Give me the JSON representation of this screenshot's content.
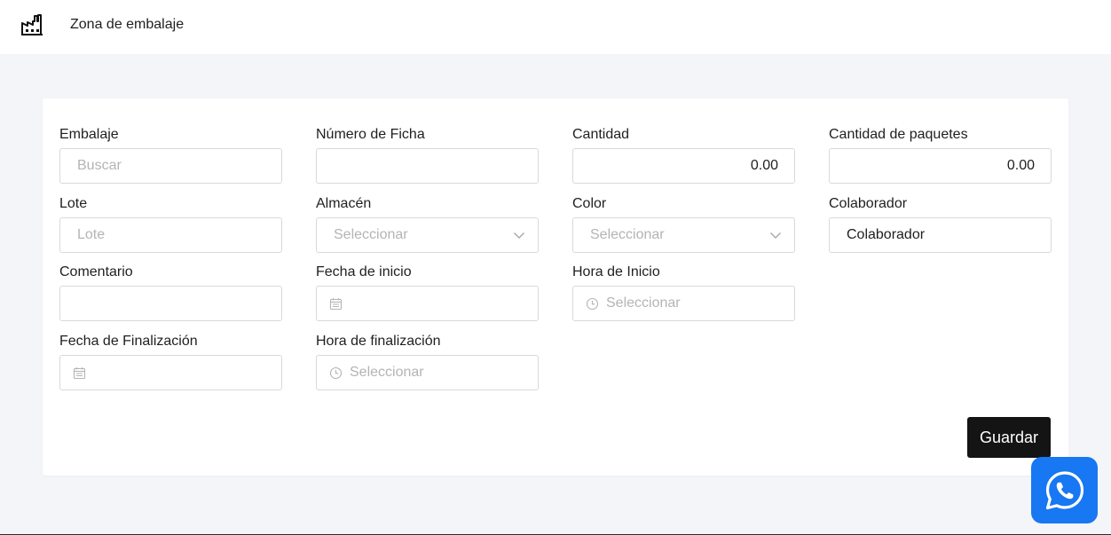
{
  "header": {
    "title": "Zona de embalaje",
    "logo_icon": "factory-icon"
  },
  "form": {
    "embalaje": {
      "label": "Embalaje",
      "placeholder": "Buscar",
      "value": ""
    },
    "numero_ficha": {
      "label": "Número de Ficha",
      "value": ""
    },
    "cantidad": {
      "label": "Cantidad",
      "value": "0.00"
    },
    "cantidad_paquetes": {
      "label": "Cantidad de paquetes",
      "value": "0.00"
    },
    "lote": {
      "label": "Lote",
      "placeholder": "Lote",
      "value": ""
    },
    "almacen": {
      "label": "Almacén",
      "placeholder": "Seleccionar",
      "value": ""
    },
    "color": {
      "label": "Color",
      "placeholder": "Seleccionar",
      "value": ""
    },
    "colaborador": {
      "label": "Colaborador",
      "value": "Colaborador"
    },
    "comentario": {
      "label": "Comentario",
      "value": ""
    },
    "fecha_inicio": {
      "label": "Fecha de inicio",
      "value": ""
    },
    "hora_inicio": {
      "label": "Hora de Inicio",
      "placeholder": "Seleccionar",
      "value": ""
    },
    "fecha_fin": {
      "label": "Fecha de Finalización",
      "value": ""
    },
    "hora_fin": {
      "label": "Hora de finalización",
      "placeholder": "Seleccionar",
      "value": ""
    }
  },
  "actions": {
    "save_label": "Guardar"
  },
  "floating": {
    "whatsapp_icon": "whatsapp-icon"
  },
  "colors": {
    "primary_button": "#141414",
    "whatsapp": "#1877f2",
    "placeholder": "#b4b4b4",
    "border": "#d9d9d9"
  }
}
